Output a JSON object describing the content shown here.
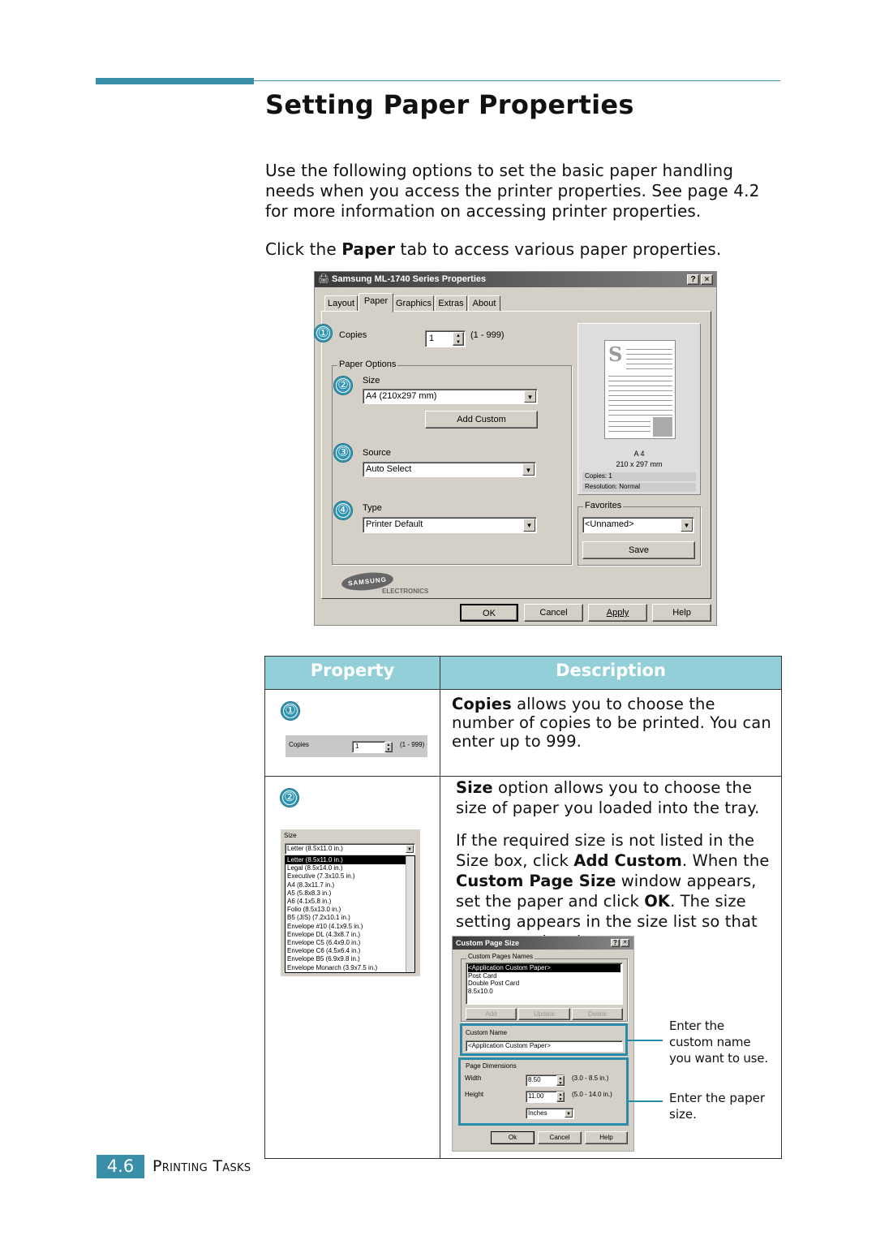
{
  "page": {
    "title": "Setting Paper Properties",
    "intro": "Use the following options to set the basic paper handling needs when you access the printer properties. See page 4.2 for more information on accessing printer properties.",
    "click_pre": "Click the ",
    "click_bold": "Paper",
    "click_post": " tab to access various paper properties.",
    "accent_color": "#3a8fa8",
    "table_header_color": "#93cfd8"
  },
  "dialog": {
    "title": "Samsung ML-1740 Series Properties",
    "help_btn": "?",
    "close_btn": "✕",
    "tabs": [
      "Layout",
      "Paper",
      "Graphics",
      "Extras",
      "About"
    ],
    "selected_tab": "Paper",
    "markers": [
      "①",
      "②",
      "③",
      "④"
    ],
    "copies_label": "Copies",
    "copies_value": "1",
    "copies_range": "(1 - 999)",
    "paper_options_label": "Paper Options",
    "size_label": "Size",
    "size_value": "A4 (210x297 mm)",
    "add_custom": "Add Custom",
    "source_label": "Source",
    "source_value": "Auto Select",
    "type_label": "Type",
    "type_value": "Printer Default",
    "preview_size": "A 4",
    "preview_dims": "210 x 297 mm",
    "preview_copies": "Copies: 1",
    "preview_resolution": "Resolution: Normal",
    "favorites_label": "Favorites",
    "favorites_value": "<Unnamed>",
    "save": "Save",
    "logo": "SAMSUNG",
    "logo_sub": "ELECTRONICS",
    "ok": "OK",
    "cancel": "Cancel",
    "apply": "Apply",
    "help": "Help"
  },
  "table": {
    "headers": [
      "Property",
      "Description"
    ],
    "row1": {
      "marker": "①",
      "mini_label": "Copies",
      "mini_value": "1",
      "mini_range": "(1 - 999)",
      "desc_bold": "Copies",
      "desc": " allows you to choose the number of copies to be printed. You can enter up to 999."
    },
    "row2": {
      "marker": "②",
      "size_label": "Size",
      "size_value": "Letter (8.5x11.0 in.)",
      "size_options": [
        "Letter (8.5x11.0 in.)",
        "Legal (8.5x14.0 in.)",
        "Executive (7.3x10.5 in.)",
        "A4 (8.3x11.7 in.)",
        "A5 (5.8x8.3 in.)",
        "A6 (4.1x5.8 in.)",
        "Folio (8.5x13.0 in.)",
        "B5 (JIS) (7.2x10.1 in.)",
        "Envelope #10 (4.1x9.5 in.)",
        "Envelope DL (4.3x8.7 in.)",
        "Envelope C5 (6.4x9.0 in.)",
        "Envelope C6 (4.5x6.4 in.)",
        "Envelope B5 (6.9x9.8 in.)",
        "Envelope Monarch (3.9x7.5 in.)"
      ],
      "p1_bold": "Size",
      "p1": " option allows you to choose the size of paper you loaded into the tray.",
      "p2_a": "If the required size is not listed in the Size box, click ",
      "p2_b": "Add Custom",
      "p2_c": ". When the ",
      "p2_d": "Custom Page Size",
      "p2_e": " window appears, set the paper and click ",
      "p2_f": "OK",
      "p2_g": ". The size setting appears in the size list so that you can select it.",
      "callout1": "Enter the custom name you want to use.",
      "callout2": "Enter the paper size."
    }
  },
  "custom_dialog": {
    "title": "Custom Page Size",
    "help_btn": "?",
    "close_btn": "✕",
    "names_label": "Custom Pages Names",
    "names": [
      "<Application Custom Paper>",
      "Post Card",
      "Double Post Card",
      "8.5x10.0"
    ],
    "add": "Add",
    "update": "Update",
    "delete": "Delete",
    "custom_name_label": "Custom Name",
    "custom_name_value": "<Application Custom Paper>",
    "dims_label": "Page Dimensions",
    "width_label": "Width",
    "width_value": "8.50",
    "width_range": "(3.0 - 8.5 in.)",
    "height_label": "Height",
    "height_value": "11.00",
    "height_range": "(5.0 - 14.0 in.)",
    "units": "Inches",
    "ok": "Ok",
    "cancel": "Cancel",
    "help": "Help"
  },
  "footer": {
    "chapter": "4.6",
    "section": "Printing Tasks"
  }
}
